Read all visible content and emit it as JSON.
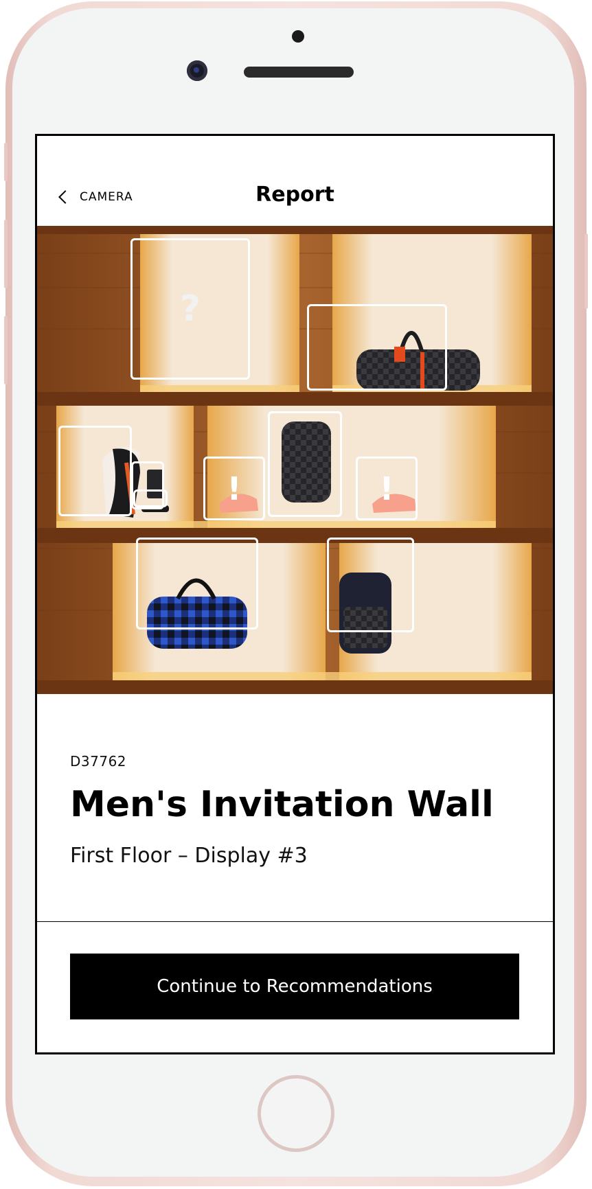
{
  "nav": {
    "back_label": "CAMERA",
    "title": "Report"
  },
  "display": {
    "code": "D37762",
    "title": "Men's Invitation Wall",
    "subtitle": "First Floor – Display #3"
  },
  "markers": {
    "unknown": "?",
    "alert": "!"
  },
  "actions": {
    "continue_label": "Continue to Recommendations"
  },
  "colors": {
    "accent": "#000000",
    "wood": "#9a5a2a",
    "shelf_light": "#f3c46b",
    "phone_frame": "#f1d9d4"
  }
}
